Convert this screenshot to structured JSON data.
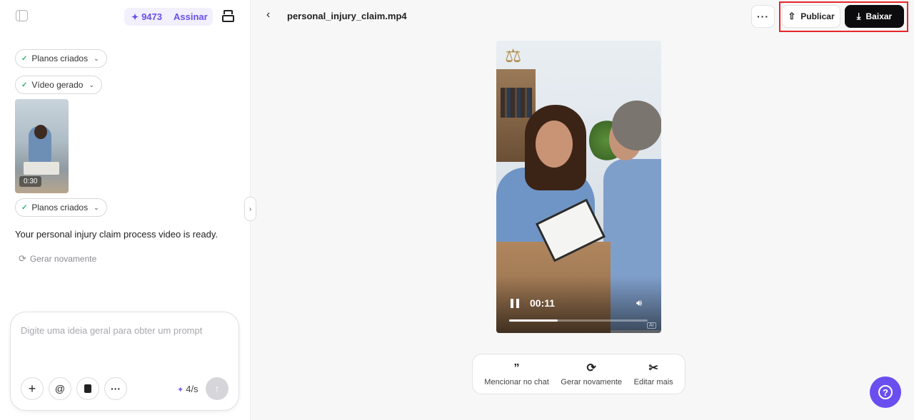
{
  "header": {
    "credits": "9473",
    "subscribe_label": "Assinar",
    "file_title": "personal_injury_claim.mp4",
    "more_label": "···",
    "publish_label": "Publicar",
    "download_label": "Baixar"
  },
  "chat": {
    "chips": [
      {
        "label": "Planos criados"
      },
      {
        "label": "Vídeo gerado"
      },
      {
        "label": "Planos criados"
      }
    ],
    "thumbnail_duration": "0:30",
    "message": "Your personal injury claim process video is ready.",
    "regenerate_label": "Gerar novamente"
  },
  "composer": {
    "placeholder": "Digite uma ideia geral para obter um prompt",
    "add_label": "+",
    "mention_label": "@",
    "more_label": "···",
    "rate": "4/s"
  },
  "player": {
    "time": "00:11",
    "progress_fraction": 0.35,
    "ai_badge": "AI"
  },
  "actions": [
    {
      "icon": "quote-icon",
      "glyph": "”",
      "label": "Mencionar no chat"
    },
    {
      "icon": "refresh-icon",
      "glyph": "⟳",
      "label": "Gerar novamente"
    },
    {
      "icon": "scissors-icon",
      "glyph": "✂",
      "label": "Editar mais"
    }
  ],
  "help_label": "?"
}
